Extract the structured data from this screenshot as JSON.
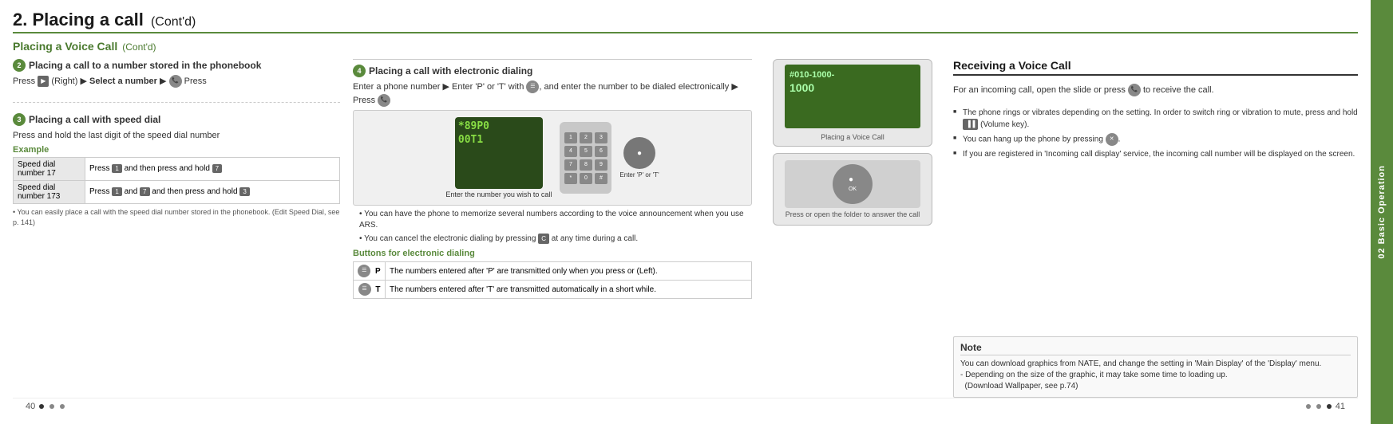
{
  "page": {
    "title": "2. Placing a call",
    "title_cont": "(Cont'd)",
    "section_title": "Placing a Voice Call",
    "section_cont": "(Cont'd)",
    "side_tab": "02 Basic Operation",
    "page_num_left": "40",
    "page_num_right": "41"
  },
  "subsection2": {
    "circle": "2",
    "title": "Placing a call to a number stored in the phonebook",
    "step": "Press  (Right)  ▶  Select a number  ▶   Press",
    "step_parts": [
      "Press",
      "(Right)  ▶",
      "Select a number  ▶",
      "Press"
    ]
  },
  "subsection3": {
    "circle": "3",
    "title": "Placing a call with speed dial",
    "step": "Press and hold the last digit of the speed dial number",
    "example_title": "Example",
    "rows": [
      {
        "label": "Speed dial number 17",
        "value": "Press  and then press and hold"
      },
      {
        "label": "Speed dial number 173",
        "value": "Press  and  and then press and hold"
      }
    ],
    "note": "• You can easily place a call with the speed dial number stored in the phonebook. (Edit Speed Dial, see p. 141)"
  },
  "subsection4": {
    "circle": "4",
    "title": "Placing a call with electronic dialing",
    "intro": "Enter a phone number ▶ Enter 'P' or 'T' with  , and enter the number to be dialed electronically ▶ Press",
    "phone_display": "*89P0\n00T1",
    "enter_label": "Enter the number you wish to call",
    "enter_label2": "Enter 'P' or 'T'",
    "bullets": [
      "You can have the phone to memorize several numbers according to the voice announcement when you use ARS.",
      "You can cancel the electronic dialing by pressing   at any time during a call."
    ],
    "buttons_title": "Buttons for electronic dialing",
    "buttons_rows": [
      {
        "key": "P",
        "desc": "The numbers entered after 'P' are transmitted only when you press  or  (Left)."
      },
      {
        "key": "T",
        "desc": "The numbers entered after 'T' are transmitted automatically in a short while."
      }
    ]
  },
  "receiving": {
    "title": "Receiving a Voice Call",
    "intro": "For an incoming call, open the slide or press   to receive the call.",
    "bullets": [
      "The phone rings or vibrates depending on the setting. In order to switch ring or vibration to mute, press and hold  (Volume key).",
      "You can hang up the phone by pressing  .",
      "If you are registered in 'Incoming call display' service, the incoming call number will be displayed on the screen."
    ],
    "phone_image_label1": "Placing a Voice Call",
    "phone_image_label2": "Press or open the folder to answer the call",
    "phone_number": "#010-1000-\n1000",
    "note_title": "Note",
    "note_text": "You can download graphics from NATE, and change the setting in 'Main Display' of the 'Display' menu.\n- Depending on the size of the graphic, it may take some time to loading up.\n  (Download Wallpaper, see p.74)"
  }
}
